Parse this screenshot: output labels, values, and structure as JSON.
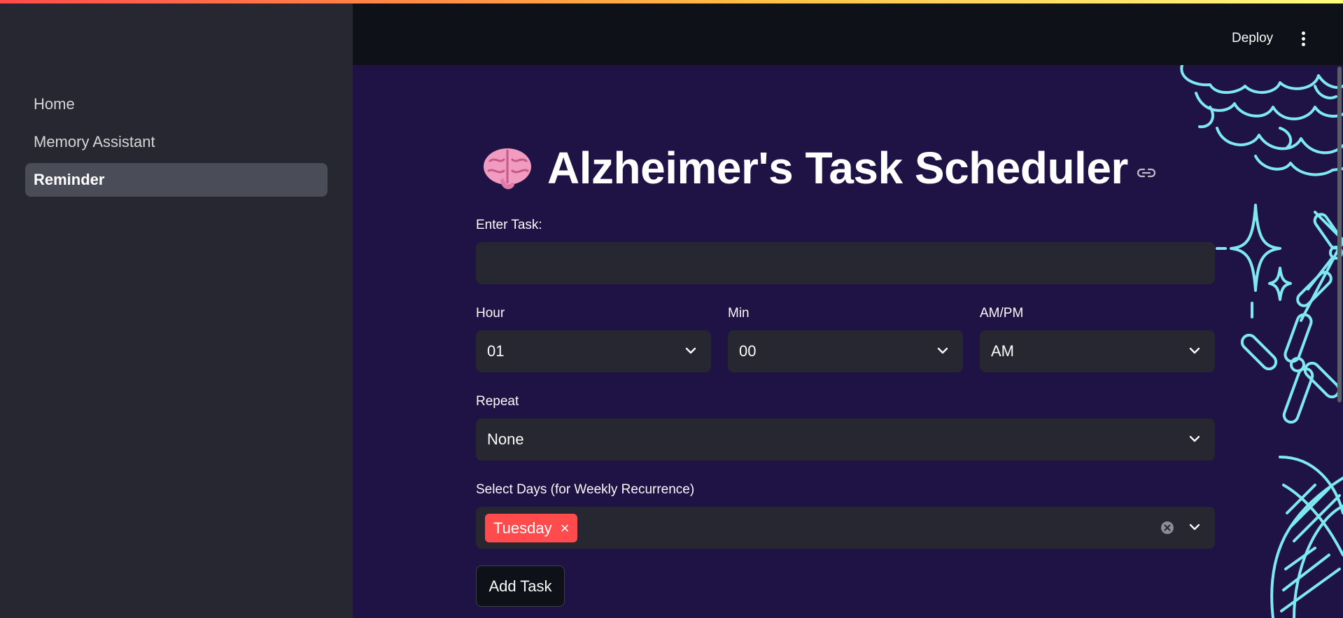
{
  "sidebar": {
    "items": [
      {
        "label": "Home"
      },
      {
        "label": "Memory Assistant"
      },
      {
        "label": "Reminder"
      }
    ]
  },
  "header": {
    "deploy_label": "Deploy",
    "menu_icon": "kebab-menu-icon"
  },
  "page": {
    "title": "Alzheimer's Task Scheduler",
    "title_icon": "brain-icon",
    "anchor_icon": "link-icon"
  },
  "form": {
    "task": {
      "label": "Enter Task:",
      "value": ""
    },
    "hour": {
      "label": "Hour",
      "value": "01"
    },
    "min": {
      "label": "Min",
      "value": "00"
    },
    "ampm": {
      "label": "AM/PM",
      "value": "AM"
    },
    "repeat": {
      "label": "Repeat",
      "value": "None"
    },
    "days": {
      "label": "Select Days (for Weekly Recurrence)",
      "selected": [
        "Tuesday"
      ],
      "remove_glyph": "×"
    },
    "add_button": "Add Task"
  },
  "colors": {
    "accent": "#ff4b4b",
    "background": "#1f1245",
    "sidebar": "#262730",
    "header": "#0e1117",
    "decoration": "#7fe9f0"
  }
}
